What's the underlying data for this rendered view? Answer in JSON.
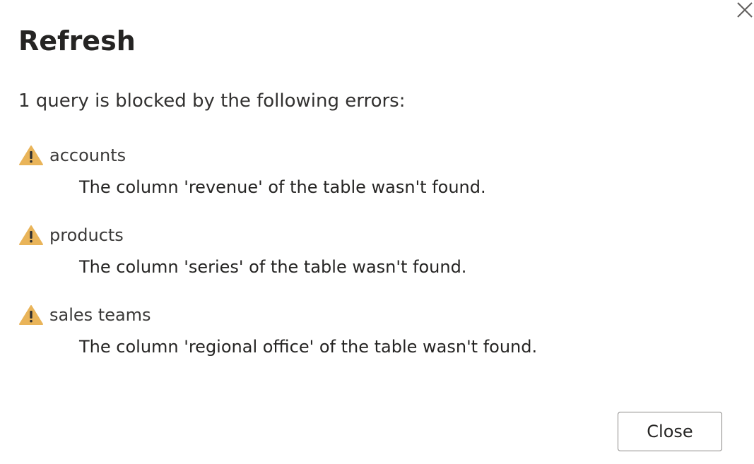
{
  "dialog": {
    "title": "Refresh",
    "close_icon": "close-x-icon",
    "summary": "1 query is blocked by the following errors:",
    "errors": [
      {
        "icon": "warning-triangle-icon",
        "query": "accounts",
        "message": "The column 'revenue' of the table wasn't found."
      },
      {
        "icon": "warning-triangle-icon",
        "query": "products",
        "message": "The column 'series' of the table wasn't found."
      },
      {
        "icon": "warning-triangle-icon",
        "query": "sales teams",
        "message": "The column 'regional office' of the table wasn't found."
      }
    ],
    "close_button_label": "Close"
  },
  "colors": {
    "warning_fill": "#e9b459",
    "warning_mark": "#323130",
    "button_border": "#8a8886",
    "text": "#252423"
  }
}
